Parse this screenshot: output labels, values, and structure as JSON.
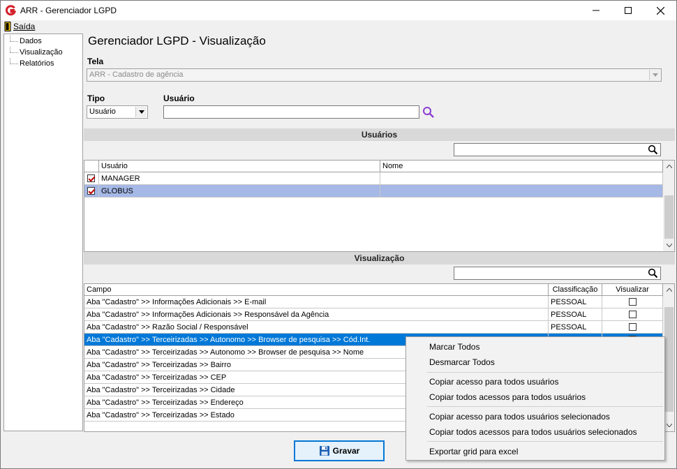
{
  "window": {
    "title": "ARR - Gerenciador LGPD"
  },
  "menu": {
    "exit_label": "Saída"
  },
  "tree": {
    "items": [
      "Dados",
      "Visualização",
      "Relatórios"
    ]
  },
  "page": {
    "title": "Gerenciador LGPD - Visualização"
  },
  "form": {
    "tela_label": "Tela",
    "tela_value": "ARR - Cadastro de agência",
    "tipo_label": "Tipo",
    "tipo_value": "Usuário",
    "usuario_label": "Usuário",
    "usuario_value": ""
  },
  "users_section": {
    "title": "Usuários",
    "search_value": "",
    "columns": [
      "Usuário",
      "Nome"
    ],
    "rows": [
      {
        "checked": true,
        "usuario": "MANAGER",
        "nome": ""
      },
      {
        "checked": true,
        "usuario": "GLOBUS",
        "nome": ""
      }
    ]
  },
  "view_section": {
    "title": "Visualização",
    "search_value": "",
    "columns": [
      "Campo",
      "Classificação",
      "Visualizar"
    ],
    "rows": [
      {
        "campo": "Aba \"Cadastro\" >> Informações Adicionais >> E-mail",
        "classificacao": "PESSOAL",
        "visualizar": false
      },
      {
        "campo": "Aba \"Cadastro\" >> Informações Adicionais >> Responsável da Agência",
        "classificacao": "PESSOAL",
        "visualizar": false
      },
      {
        "campo": "Aba \"Cadastro\" >> Razão Social / Responsável",
        "classificacao": "PESSOAL",
        "visualizar": false
      },
      {
        "campo": "Aba \"Cadastro\" >> Terceirizadas >> Autonomo >> Browser de pesquisa >> Cód.Int.",
        "classificacao": "",
        "visualizar": false
      },
      {
        "campo": "Aba \"Cadastro\" >> Terceirizadas >> Autonomo >> Browser de pesquisa >> Nome",
        "classificacao": "",
        "visualizar": false
      },
      {
        "campo": "Aba \"Cadastro\" >> Terceirizadas >> Bairro",
        "classificacao": "",
        "visualizar": false
      },
      {
        "campo": "Aba \"Cadastro\" >> Terceirizadas >> CEP",
        "classificacao": "",
        "visualizar": false
      },
      {
        "campo": "Aba \"Cadastro\" >> Terceirizadas >> Cidade",
        "classificacao": "",
        "visualizar": false
      },
      {
        "campo": "Aba \"Cadastro\" >> Terceirizadas >> Endereço",
        "classificacao": "",
        "visualizar": false
      },
      {
        "campo": "Aba \"Cadastro\" >> Terceirizadas >> Estado",
        "classificacao": "",
        "visualizar": false
      }
    ]
  },
  "save_button": {
    "label": "Gravar"
  },
  "context_menu": {
    "items": [
      "Marcar Todos",
      "Desmarcar Todos",
      "Copiar acesso para todos usuários",
      "Copiar todos acessos para todos usuários",
      "Copiar acesso para todos usuários selecionados",
      "Copiar todos acessos para todos usuários selecionados",
      "Exportar grid para excel"
    ]
  },
  "colors": {
    "selection_blue": "#0078d7",
    "selection_light": "#a5b8e6",
    "brand_red": "#d4202a",
    "search_purple": "#8a3fd1"
  }
}
